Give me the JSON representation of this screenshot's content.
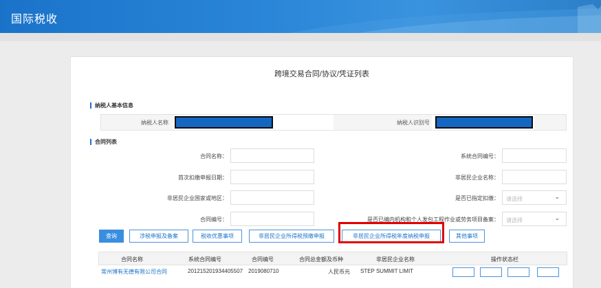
{
  "header": {
    "title": "国际税收"
  },
  "page": {
    "title": "跨境交易合同/协议/凭证列表"
  },
  "taxpayer_section": {
    "title": "纳税人基本信息",
    "name_label": "纳税人名称",
    "id_label": "纳税人识别号"
  },
  "contract_section": {
    "title": "合同列表",
    "fields": {
      "contract_name": "合同名称：",
      "system_contract_no": "系统合同编号：",
      "first_withholding_date": "首次扣缴申报日期：",
      "nonresident_name": "非居民企业名称：",
      "nonresident_country": "非居民企业国家或地区：",
      "designated_withholding": "是否已指定扣缴：",
      "contract_no": "合同编号：",
      "filed_project": "是否已编内机构和个人发包工程作业或劳务项目备案："
    },
    "select_placeholder": "请选择"
  },
  "buttons": {
    "query": "查询",
    "tax_filing": "涉税申报及备案",
    "tax_incentives": "税收优惠事项",
    "prepayment": "非居民企业所得税预缴申报",
    "annual": "非居民企业所得税年度纳税申报",
    "other": "其他事项"
  },
  "table": {
    "columns": [
      "合同名称",
      "系统合同编号",
      "合同编号",
      "合同总金额及币种",
      "非居民企业名称",
      "操作状态栏"
    ],
    "rows": [
      [
        "常州博有无德有限公司合同",
        "201215201934405507",
        "2019080710",
        "人民币元",
        "STEP SUMMIT LIMIT"
      ]
    ]
  },
  "colors": {
    "accent": "#1a73c9",
    "highlight": "#e10000",
    "redaction": "#1566c0"
  }
}
